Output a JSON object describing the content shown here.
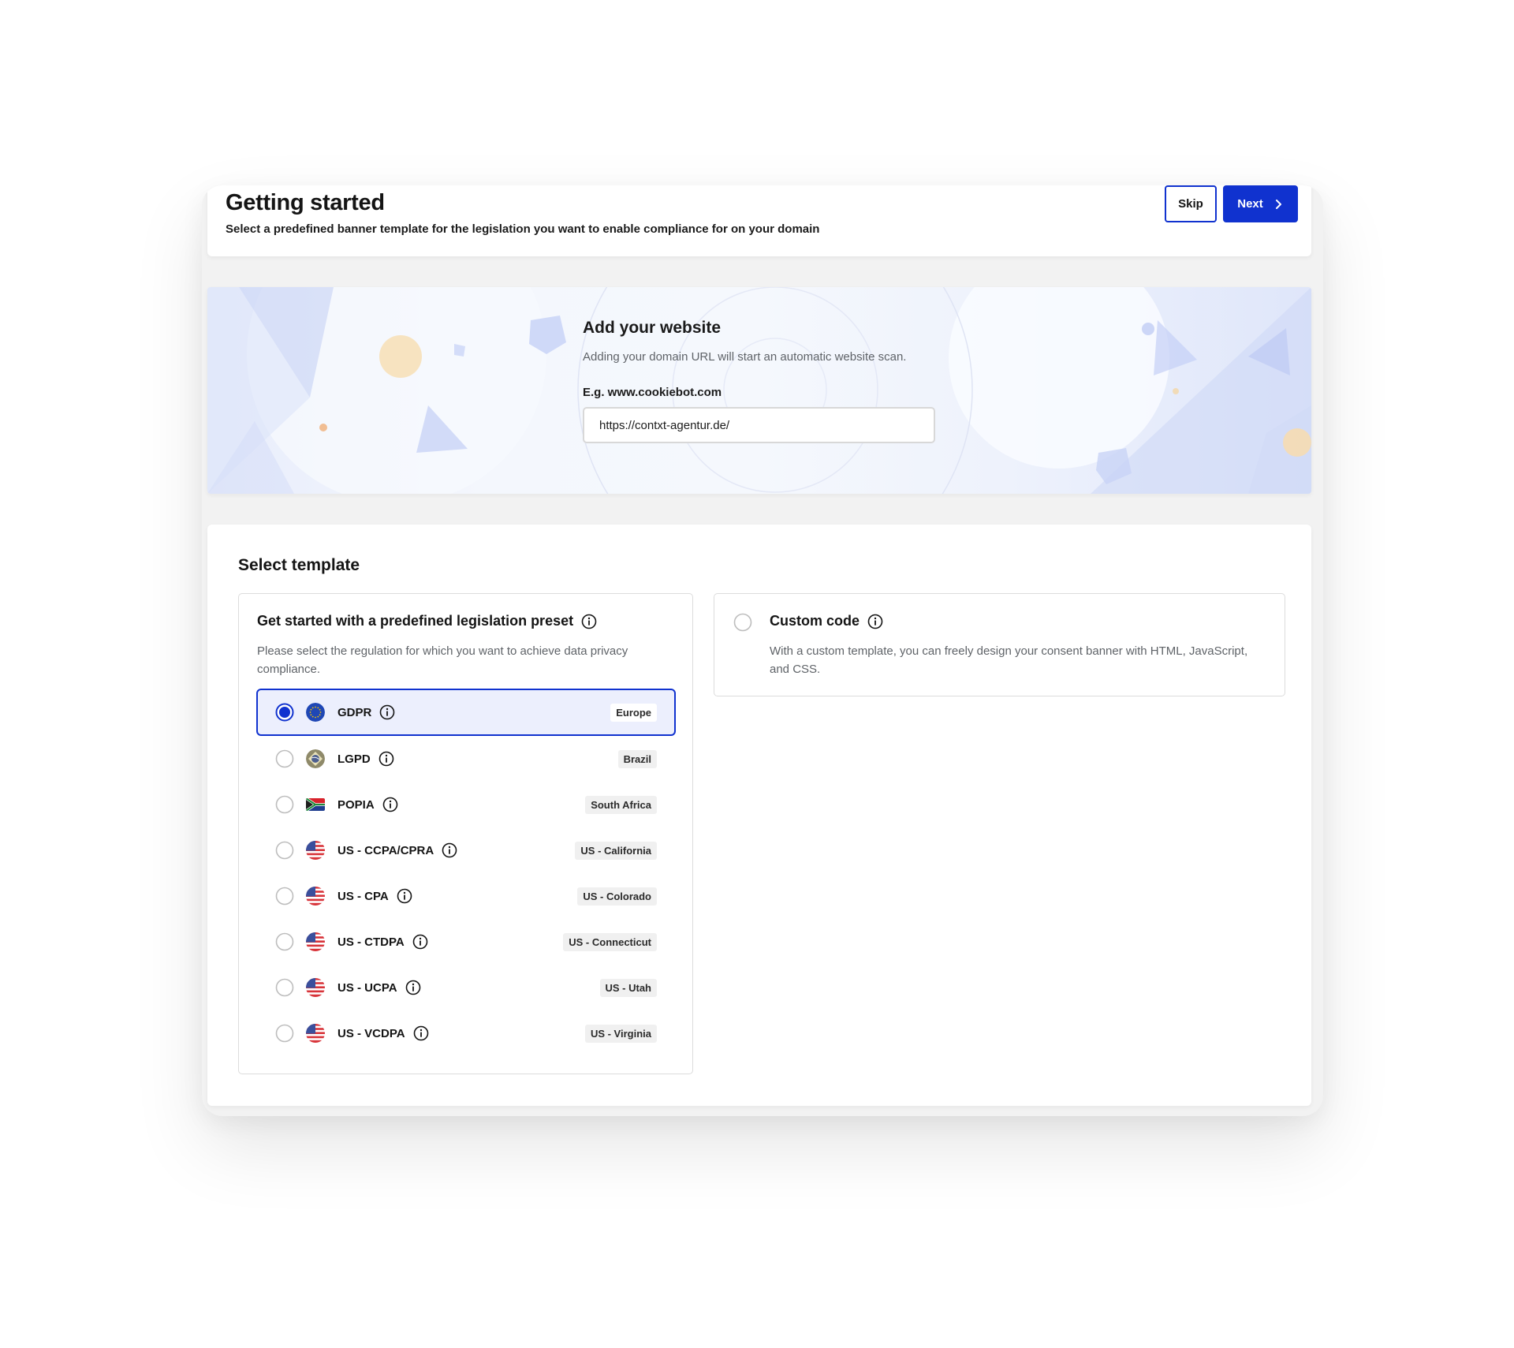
{
  "header": {
    "title": "Getting started",
    "subtitle": "Select a predefined banner template for the legislation you want to enable compliance for on your domain",
    "skip_label": "Skip",
    "next_label": "Next"
  },
  "website": {
    "title": "Add your website",
    "description": "Adding your domain URL will start an automatic website scan.",
    "field_label": "E.g. www.cookiebot.com",
    "url_value": "https://contxt-agentur.de/"
  },
  "template": {
    "section_title": "Select template",
    "preset": {
      "title": "Get started with a predefined legislation preset",
      "description": "Please select the regulation for which you want to achieve data privacy compliance."
    },
    "custom": {
      "title": "Custom code",
      "description": "With a custom template, you can freely design your consent banner with HTML, JavaScript, and CSS."
    },
    "regulations": [
      {
        "name": "GDPR",
        "region": "Europe",
        "flag": "eu-flag-icon",
        "selected": true
      },
      {
        "name": "LGPD",
        "region": "Brazil",
        "flag": "brazil-flag-icon",
        "selected": false
      },
      {
        "name": "POPIA",
        "region": "South Africa",
        "flag": "south-africa-flag-icon",
        "selected": false
      },
      {
        "name": "US - CCPA/CPRA",
        "region": "US - California",
        "flag": "us-flag-icon",
        "selected": false
      },
      {
        "name": "US - CPA",
        "region": "US - Colorado",
        "flag": "us-flag-icon",
        "selected": false
      },
      {
        "name": "US - CTDPA",
        "region": "US - Connecticut",
        "flag": "us-flag-icon",
        "selected": false
      },
      {
        "name": "US - UCPA",
        "region": "US - Utah",
        "flag": "us-flag-icon",
        "selected": false
      },
      {
        "name": "US - VCDPA",
        "region": "US - Virginia",
        "flag": "us-flag-icon",
        "selected": false
      }
    ]
  },
  "colors": {
    "primary": "#1032cf",
    "selected_bg": "#eceffd",
    "tag_bg": "#f0f0f0",
    "border": "#dcdcdc"
  }
}
